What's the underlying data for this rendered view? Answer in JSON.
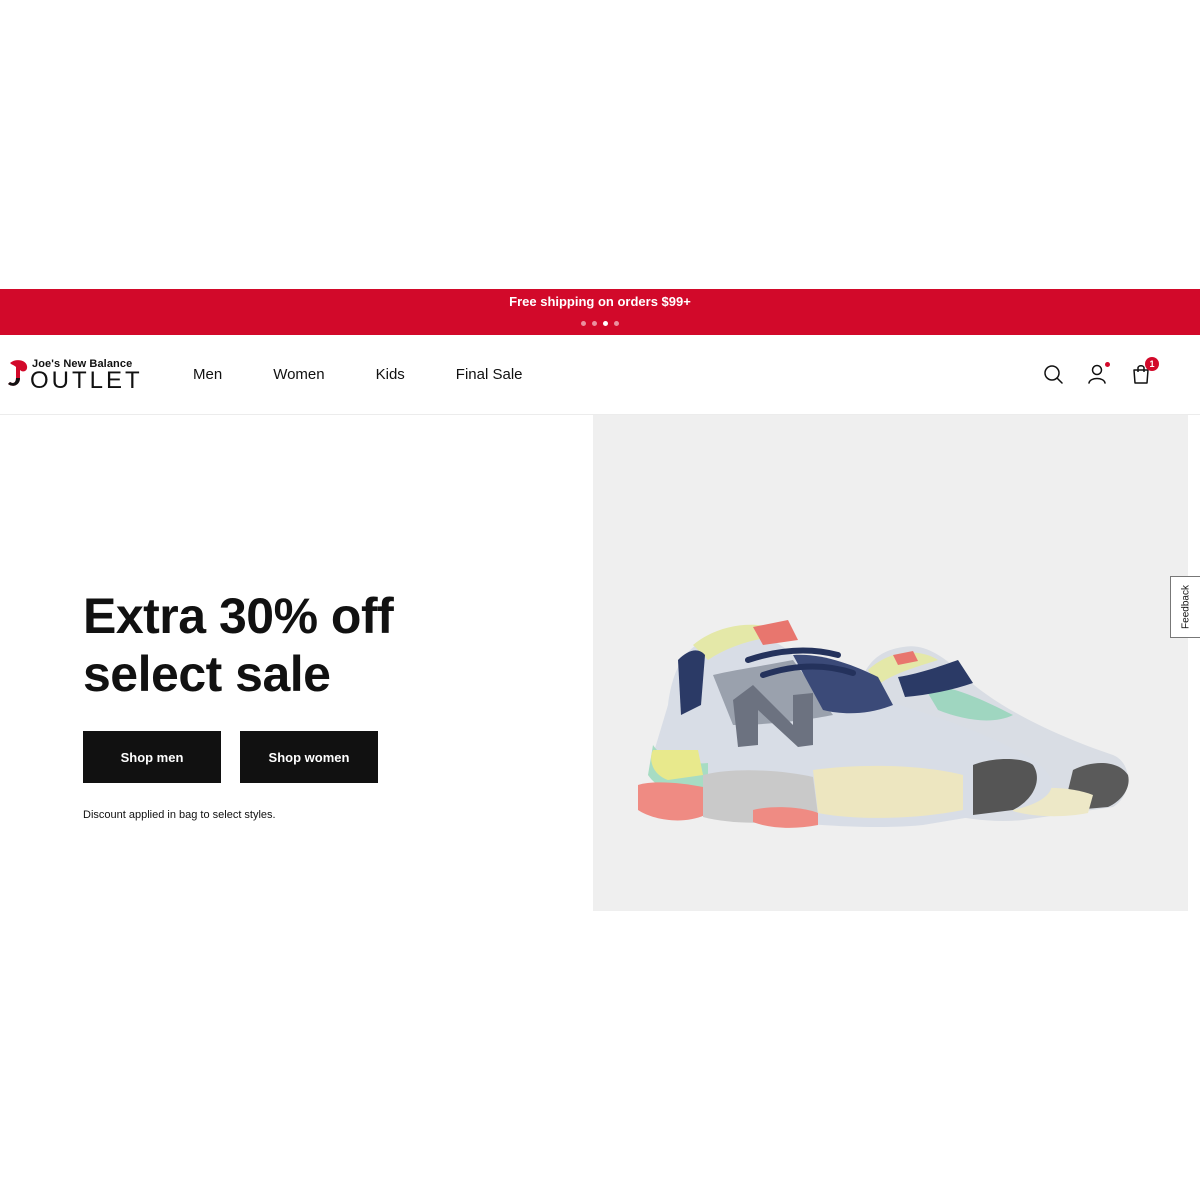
{
  "promo": {
    "message": "Free shipping on orders $99+",
    "dot_count": 4,
    "active_dot_index": 2
  },
  "header": {
    "logo": {
      "top_text": "Joe's New Balance",
      "main_text": "OUTLET"
    },
    "nav": [
      {
        "label": "Men"
      },
      {
        "label": "Women"
      },
      {
        "label": "Kids"
      },
      {
        "label": "Final Sale"
      }
    ],
    "icons": [
      "search-icon",
      "account-icon",
      "shopping-bag-icon"
    ],
    "cart_count": "1"
  },
  "hero": {
    "title": "Extra 30% off\nselect sale",
    "buttons": {
      "shop_men": "Shop men",
      "shop_women": "Shop women"
    },
    "disclaimer": "Discount applied in bag to select styles."
  },
  "feedback": {
    "label": "Feedback"
  },
  "colors": {
    "brand_red": "#d2092a",
    "button_black": "#111111",
    "hero_image_bg": "#efefef"
  }
}
